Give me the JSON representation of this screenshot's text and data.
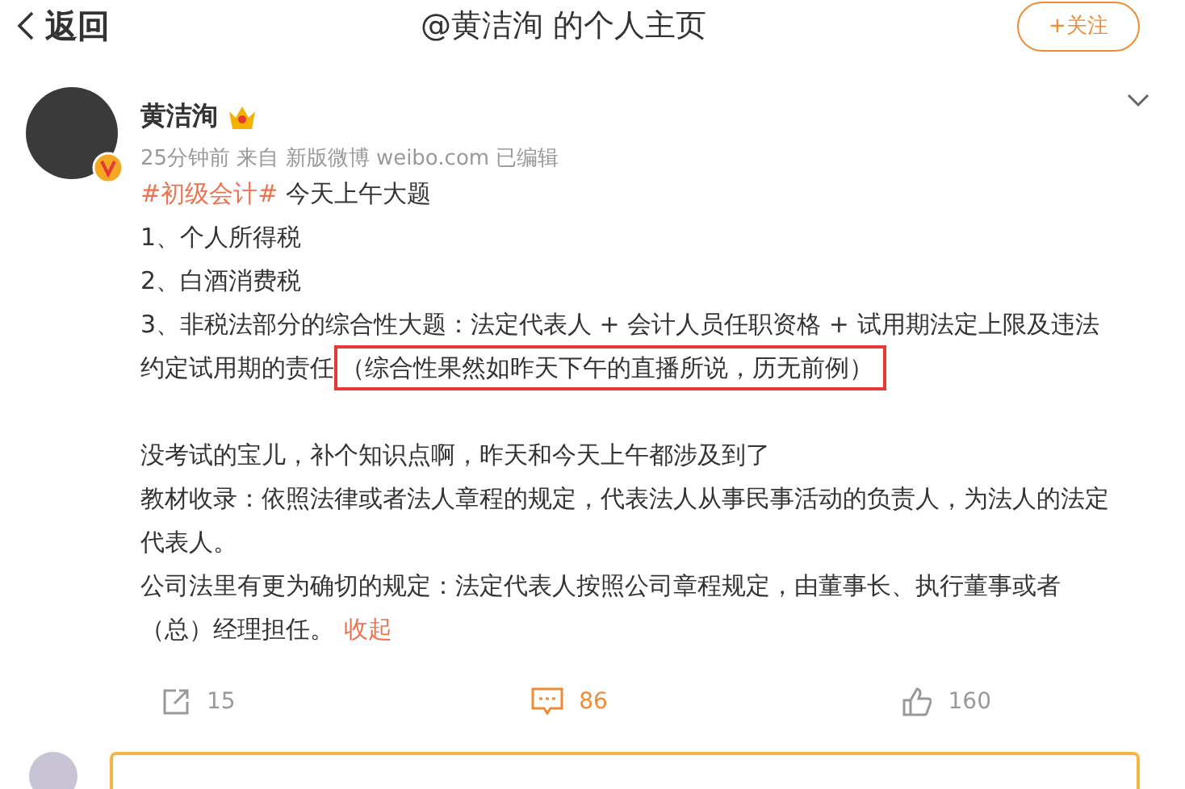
{
  "header": {
    "back_label": "返回",
    "title": "@黄洁洵 的个人主页",
    "follow_label": "+关注"
  },
  "post": {
    "author": "黄洁洵",
    "meta": "25分钟前 来自 新版微博 weibo.com 已编辑",
    "paragraphs": [
      {
        "kind": "topic",
        "topic": "#初级会计#",
        "text": " 今天上午大题"
      },
      {
        "kind": "plain",
        "text": "1、个人所得税"
      },
      {
        "kind": "plain",
        "text": "2、白酒消费税"
      },
      {
        "kind": "highlight",
        "text": "3、非税法部分的综合性大题：法定代表人 + 会计人员任职资格 + 试用期法定上限及违法约定试用期的责任",
        "highlight": "（综合性果然如昨天下午的直播所说，历无前例）"
      },
      {
        "kind": "gap"
      },
      {
        "kind": "plain",
        "text": "没考试的宝儿，补个知识点啊，昨天和今天上午都涉及到了"
      },
      {
        "kind": "plain",
        "text": "教材收录：依照法律或者法人章程的规定，代表法人从事民事活动的负责人，为法人的法定代表人。"
      },
      {
        "kind": "collapse",
        "text": "公司法里有更为确切的规定：法定代表人按照公司章程规定，由董事长、执行董事或者（总）经理担任。",
        "link": "收起"
      }
    ],
    "actions": [
      {
        "kind": "share",
        "count": "15",
        "selected": false
      },
      {
        "kind": "comment",
        "count": "86",
        "selected": true
      },
      {
        "kind": "like",
        "count": "160",
        "selected": false
      }
    ]
  }
}
